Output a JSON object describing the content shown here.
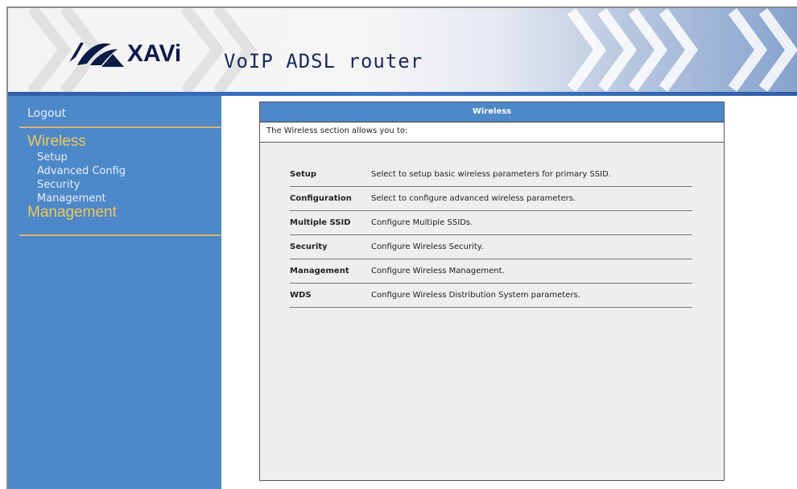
{
  "header": {
    "logo_text": "XAVi",
    "product_title": "VoIP ADSL router"
  },
  "sidebar": {
    "logout": "Logout",
    "sections": [
      {
        "label": "Wireless",
        "items": [
          "Setup",
          "Advanced Config",
          "Security",
          "Management"
        ]
      },
      {
        "label": "Management",
        "items": []
      }
    ]
  },
  "panel": {
    "title": "Wireless",
    "intro": "The Wireless section allows you to:",
    "rows": [
      {
        "label": "Setup",
        "desc": "Select to setup basic wireless parameters for primary SSID."
      },
      {
        "label": "Configuration",
        "desc": "Select to configure advanced wireless parameters."
      },
      {
        "label": "Multiple SSID",
        "desc": "Configure Multiple SSIDs."
      },
      {
        "label": "Security",
        "desc": "Configure Wireless Security."
      },
      {
        "label": "Management",
        "desc": "Configure Wireless Management."
      },
      {
        "label": "WDS",
        "desc": "Configure Wireless Distribution System parameters."
      }
    ]
  },
  "colors": {
    "sidebar_bg": "#4d88c8",
    "section_heading": "#f0c75a",
    "panel_header_bg": "#4d88c8"
  }
}
